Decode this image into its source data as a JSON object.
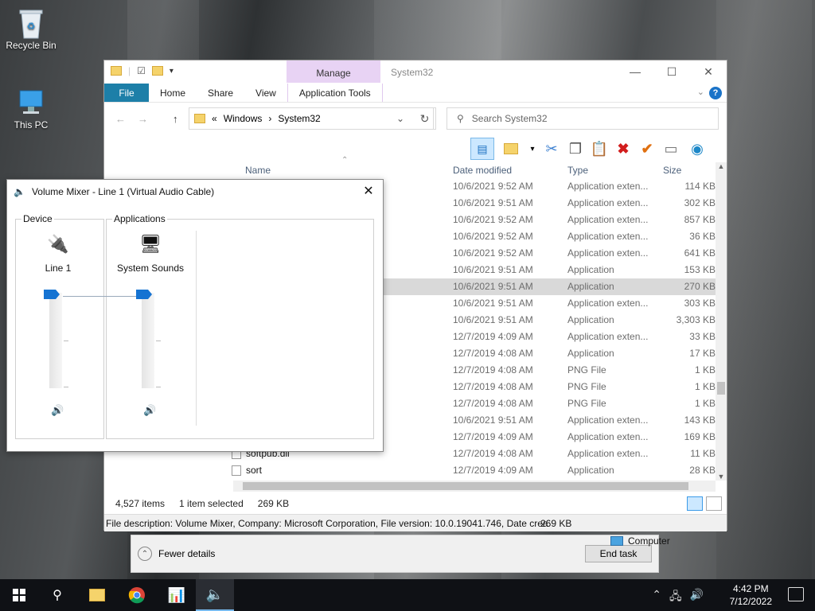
{
  "desktop": {
    "icons": [
      {
        "label": "Recycle Bin",
        "icon": "recycle-bin-icon"
      },
      {
        "label": "This PC",
        "icon": "computer-icon"
      }
    ]
  },
  "task_manager": {
    "fewer_details": "Fewer details",
    "end_task": "End task"
  },
  "explorer": {
    "title": "System32",
    "context_tab": "Manage",
    "tabs": [
      "File",
      "Home",
      "Share",
      "View",
      "Application Tools"
    ],
    "breadcrumb": [
      "«",
      "Windows",
      "›",
      "System32"
    ],
    "search_placeholder": "Search System32",
    "columns": {
      "name": "Name",
      "date": "Date modified",
      "type": "Type",
      "size": "Size"
    },
    "rows": [
      {
        "name": "",
        "date": "10/6/2021 9:52 AM",
        "type": "Application exten...",
        "size": "114 KB"
      },
      {
        "name": "",
        "date": "10/6/2021 9:51 AM",
        "type": "Application exten...",
        "size": "302 KB"
      },
      {
        "name": "",
        "date": "10/6/2021 9:52 AM",
        "type": "Application exten...",
        "size": "857 KB"
      },
      {
        "name": "",
        "date": "10/6/2021 9:52 AM",
        "type": "Application exten...",
        "size": "36 KB"
      },
      {
        "name": "",
        "date": "10/6/2021 9:52 AM",
        "type": "Application exten...",
        "size": "641 KB"
      },
      {
        "name": "",
        "date": "10/6/2021 9:51 AM",
        "type": "Application",
        "size": "153 KB"
      },
      {
        "name": "",
        "date": "10/6/2021 9:51 AM",
        "type": "Application",
        "size": "270 KB",
        "selected": true
      },
      {
        "name": "",
        "date": "10/6/2021 9:51 AM",
        "type": "Application exten...",
        "size": "303 KB"
      },
      {
        "name": "",
        "date": "10/6/2021 9:51 AM",
        "type": "Application",
        "size": "3,303 KB"
      },
      {
        "name": "",
        "date": "12/7/2019 4:09 AM",
        "type": "Application exten...",
        "size": "33 KB"
      },
      {
        "name": "",
        "date": "12/7/2019 4:08 AM",
        "type": "Application",
        "size": "17 KB"
      },
      {
        "name": "",
        "date": "12/7/2019 4:08 AM",
        "type": "PNG File",
        "size": "1 KB"
      },
      {
        "name": "",
        "date": "12/7/2019 4:08 AM",
        "type": "PNG File",
        "size": "1 KB"
      },
      {
        "name": "",
        "date": "12/7/2019 4:08 AM",
        "type": "PNG File",
        "size": "1 KB"
      },
      {
        "name": "",
        "date": "10/6/2021 9:51 AM",
        "type": "Application exten...",
        "size": "143 KB"
      },
      {
        "name": "",
        "date": "12/7/2019 4:09 AM",
        "type": "Application exten...",
        "size": "169 KB"
      },
      {
        "name": "softpub.dll",
        "date": "12/7/2019 4:08 AM",
        "type": "Application exten...",
        "size": "11 KB"
      },
      {
        "name": "sort",
        "date": "12/7/2019 4:09 AM",
        "type": "Application",
        "size": "28 KB"
      }
    ],
    "status": {
      "items": "4,527 items",
      "selected": "1 item selected",
      "size": "269 KB"
    },
    "description": "File description: Volume Mixer, Company: Microsoft Corporation, File version: 10.0.19041.746, Date crea",
    "description_size": "269 KB",
    "description_location": "Computer"
  },
  "volume_mixer": {
    "title": "Volume Mixer - Line 1 (Virtual Audio Cable)",
    "device_label": "Device",
    "applications_label": "Applications",
    "device": {
      "name": "Line 1",
      "level": 1.0
    },
    "apps": [
      {
        "name": "System Sounds",
        "level": 1.0
      }
    ]
  },
  "taskbar": {
    "time": "4:42 PM",
    "date": "7/12/2022"
  }
}
